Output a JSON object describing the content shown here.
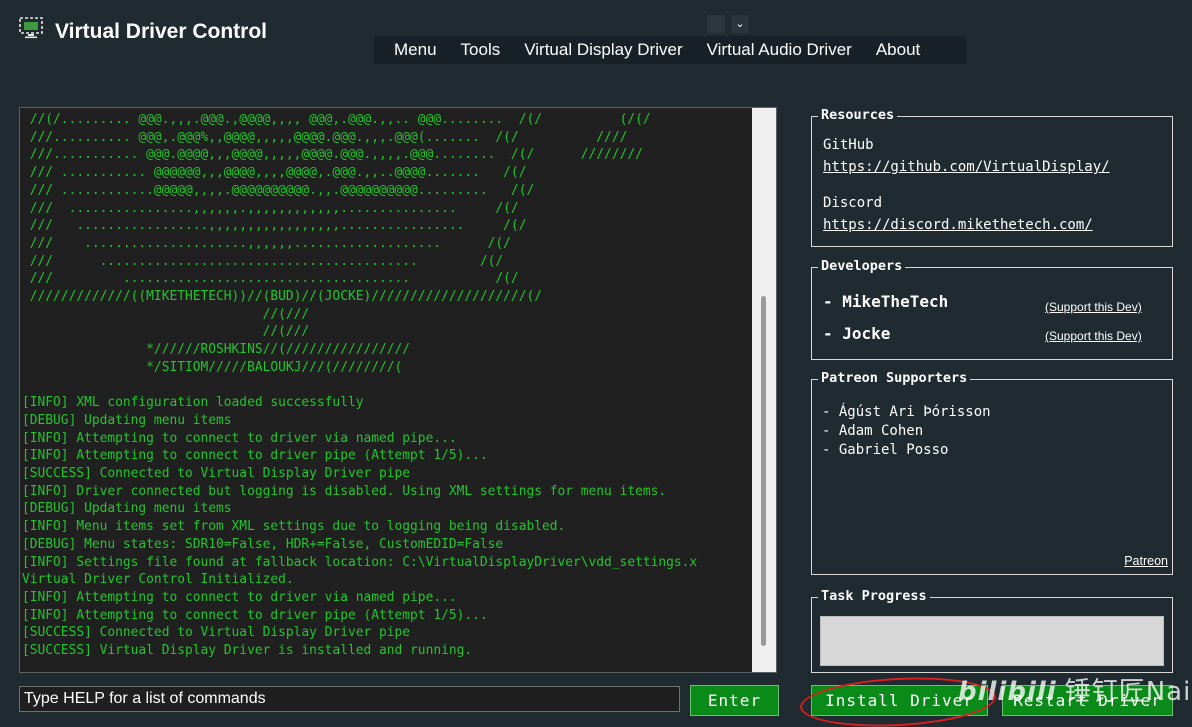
{
  "window": {
    "title": "Virtual Driver Control",
    "dropdown_glyph": "⌄"
  },
  "menu": [
    {
      "label": "Menu"
    },
    {
      "label": "Tools"
    },
    {
      "label": "Virtual Display Driver"
    },
    {
      "label": "Virtual Audio Driver"
    },
    {
      "label": "About"
    }
  ],
  "console": {
    "text": " //(/......... @@@.,,,.@@@.,@@@@,,,, @@@,.@@@.,,.. @@@........  /(/          (/(/\n ///.......... @@@,.@@@%,,@@@@,,,,,@@@@.@@@.,,,.@@@(.......  /(/          ////\n ///........... @@@.@@@@,,,@@@@,,,,,@@@@.@@@.,,,,.@@@........  /(/      ////////\n /// ........... @@@@@@,,,@@@@,,,,@@@@,.@@@.,,..@@@@.......   /(/\n /// ............@@@@@,,,,.@@@@@@@@@@.,,.@@@@@@@@@@.........   /(/\n ///  ................,,,,,,.,,,,,,,,,,,,...............     /(/\n ///   .................,,,,,,,,,,,,,,,,,................     /(/\n ///    .....................,,,,,,...................      /(/\n ///      .........................................        /(/\n ///         .....................................           /(/\n /////////////((MIKETHETECH))//(BUD)//(JOCKE)////////////////////(/\n                               //(///\n                               //(///\n                *//////ROSHKINS//(////////////////\n                */SITIOM/////BALOUKJ///(////////(\n\n[INFO] XML configuration loaded successfully\n[DEBUG] Updating menu items\n[INFO] Attempting to connect to driver via named pipe...\n[INFO] Attempting to connect to driver pipe (Attempt 1/5)...\n[SUCCESS] Connected to Virtual Display Driver pipe\n[INFO] Driver connected but logging is disabled. Using XML settings for menu items.\n[DEBUG] Updating menu items\n[INFO] Menu items set from XML settings due to logging being disabled.\n[DEBUG] Menu states: SDR10=False, HDR+=False, CustomEDID=False\n[INFO] Settings file found at fallback location: C:\\VirtualDisplayDriver\\vdd_settings.x\nVirtual Driver Control Initialized.\n[INFO] Attempting to connect to driver via named pipe...\n[INFO] Attempting to connect to driver pipe (Attempt 1/5)...\n[SUCCESS] Connected to Virtual Display Driver pipe\n[SUCCESS] Virtual Display Driver is installed and running.",
    "text_color": "#22c52c"
  },
  "command": {
    "placeholder": "Type HELP for a list of commands",
    "enter_label": "Enter"
  },
  "buttons": {
    "install_label": "Install Driver",
    "restart_label": "Restart Driver",
    "color": "#0a8a19"
  },
  "resources": {
    "title": "Resources",
    "github_label": "GitHub",
    "github_url": "https://github.com/VirtualDisplay/",
    "discord_label": "Discord",
    "discord_url": "https://discord.mikethetech.com/"
  },
  "developers": {
    "title": "Developers",
    "items": [
      {
        "name": "- MikeTheTech",
        "support": "(Support this Dev)"
      },
      {
        "name": "- Jocke",
        "support": "(Support this Dev)"
      }
    ]
  },
  "patreon": {
    "title": "Patreon Supporters",
    "supporters": [
      "- Ágúst Ari Þórisson",
      "- Adam Cohen",
      "- Gabriel Posso"
    ],
    "link": "Patreon"
  },
  "progress": {
    "title": "Task Progress",
    "value": 0
  },
  "watermark": {
    "brand": "bilibili",
    "text": "锤钉匠Nail"
  }
}
